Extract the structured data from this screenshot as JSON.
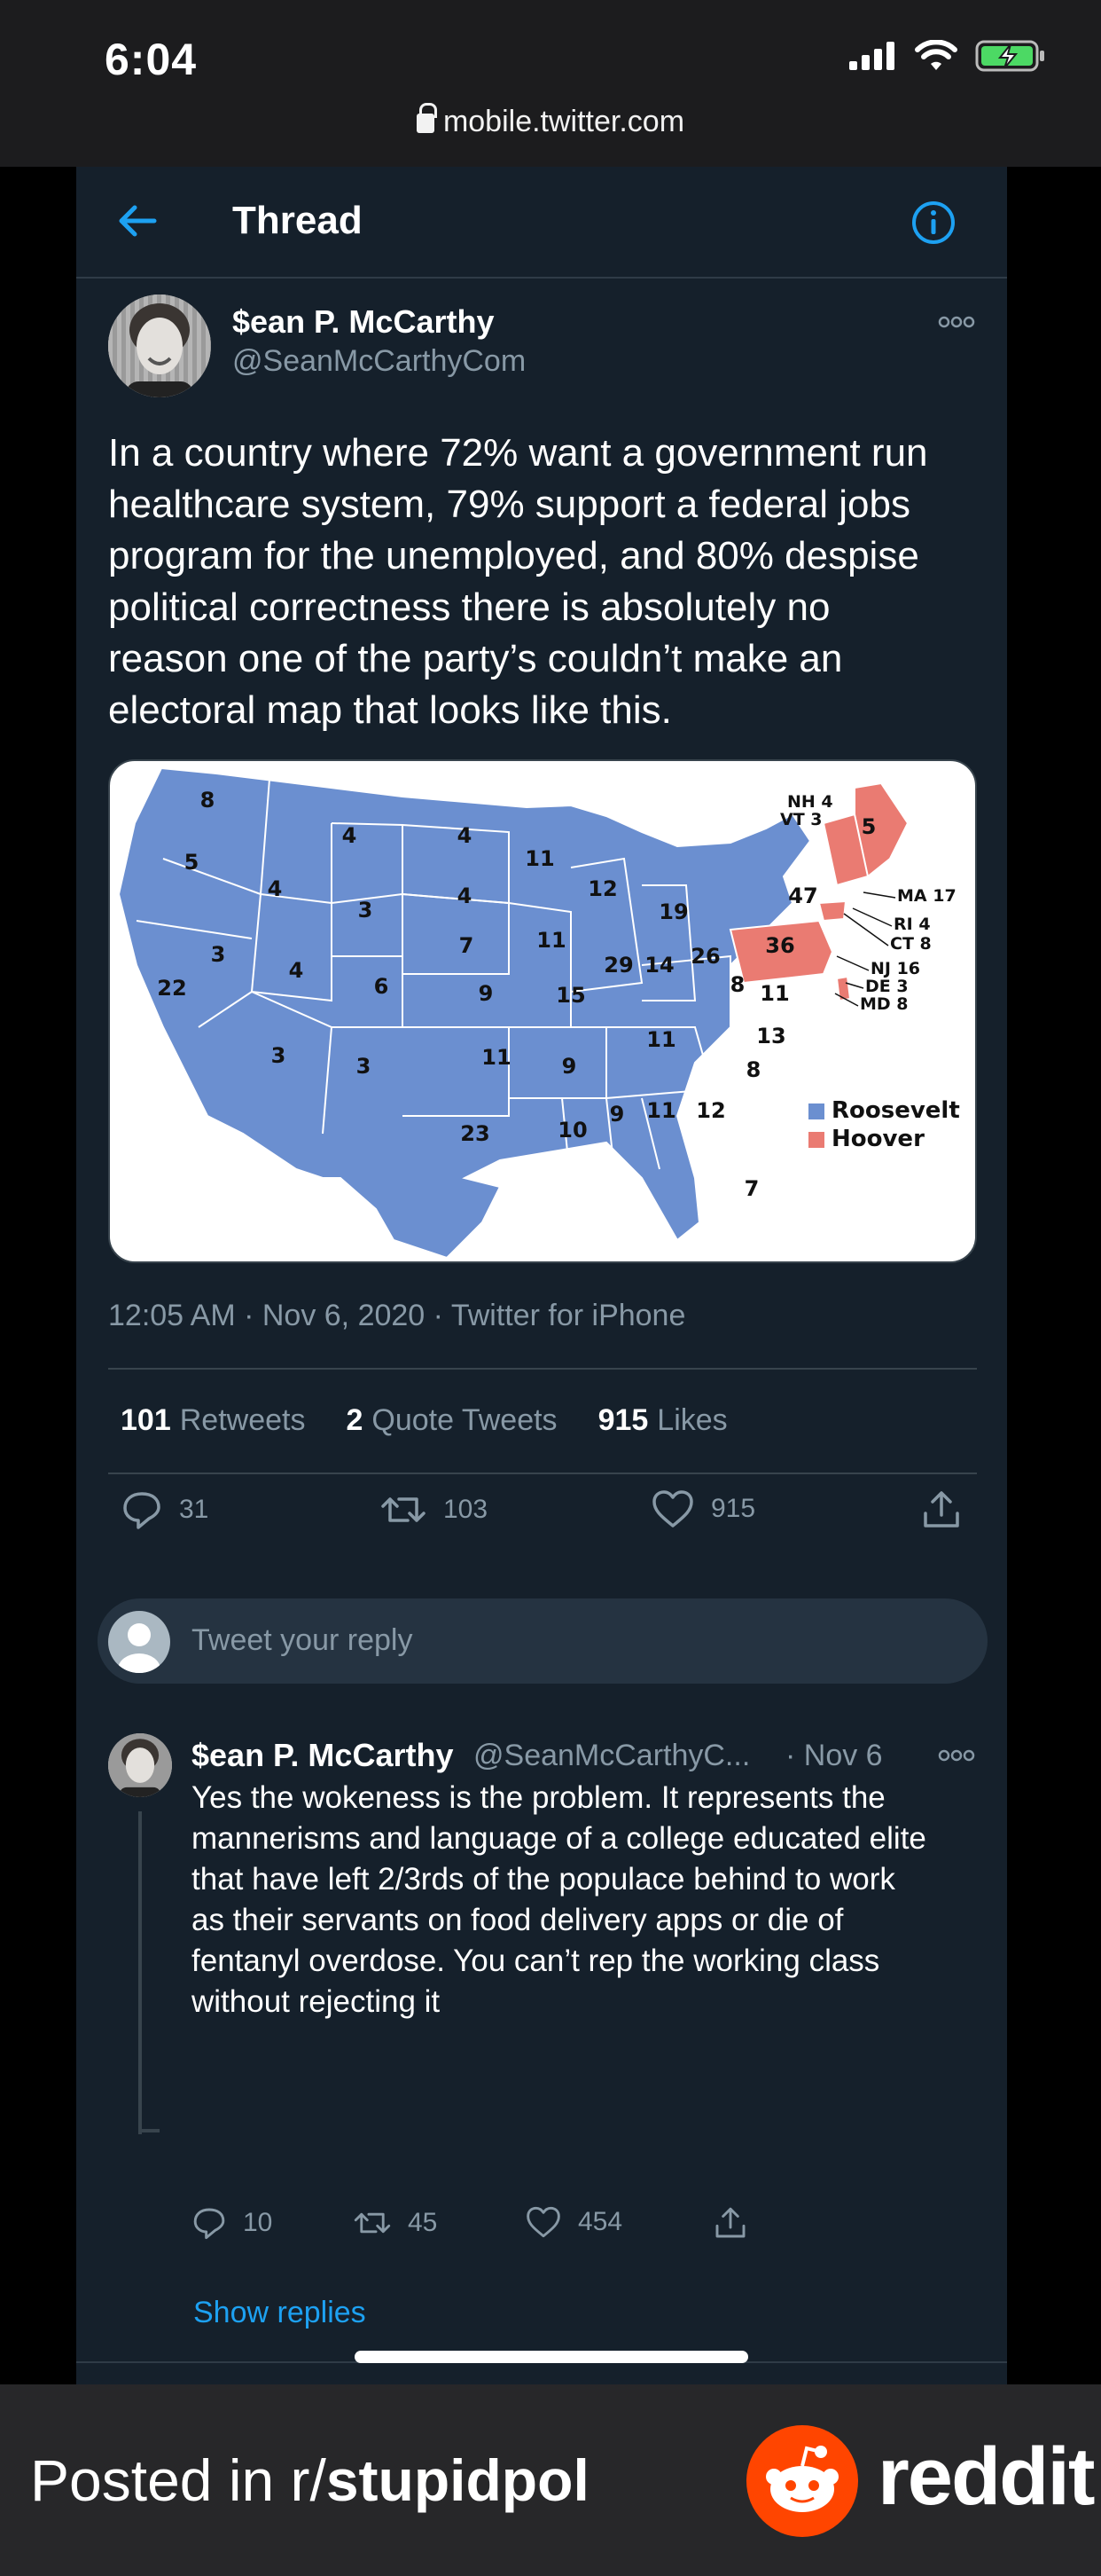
{
  "status": {
    "time": "6:04",
    "url": "mobile.twitter.com"
  },
  "header": {
    "title": "Thread"
  },
  "tweet": {
    "author_name": "$ean P. McCarthy",
    "author_handle": "@SeanMcCarthyCom",
    "lines": [
      "In a country where 72% want a government run",
      "healthcare system, 79% support a federal jobs",
      "program for the unemployed, and 80% despise",
      "political correctness there is absolutely no",
      "reason one of the party’s couldn’t make an",
      "electoral map that looks like this."
    ],
    "meta": "12:05 AM · Nov 6, 2020 · Twitter for iPhone",
    "retweets_count": "101",
    "retweets_label": "Retweets",
    "quote_count": "2",
    "quote_label": "Quote Tweets",
    "likes_count": "915",
    "likes_label": "Likes",
    "action_replies": "31",
    "action_retweets": "103",
    "action_likes": "915"
  },
  "map": {
    "state_numbers": [
      "8",
      "4",
      "4",
      "11",
      "5",
      "4",
      "3",
      "4",
      "12",
      "19",
      "3",
      "4",
      "7",
      "11",
      "22",
      "6",
      "9",
      "15",
      "29",
      "14",
      "26",
      "36",
      "8",
      "11",
      "3",
      "3",
      "11",
      "9",
      "11",
      "13",
      "8",
      "23",
      "10",
      "9",
      "11",
      "12",
      "7",
      "5"
    ],
    "ne_labels": [
      "NH 4",
      "VT 3",
      "MA 17",
      "RI 4",
      "CT 8",
      "NJ 16",
      "DE 3",
      "MD 8",
      "47"
    ],
    "legend_roosevelt": "Roosevelt",
    "legend_hoover": "Hoover",
    "colors": {
      "roosevelt": "#6b8fd0",
      "hoover": "#ea7b72"
    }
  },
  "reply_box": {
    "placeholder": "Tweet your reply"
  },
  "reply": {
    "author_name": "$ean P. McCarthy",
    "author_handle": "@SeanMcCarthyC...",
    "date": "· Nov 6",
    "lines": [
      "Yes the wokeness is the problem. It represents the",
      "mannerisms and language of a college educated elite",
      "that have left 2/3rds of the populace behind to work",
      "as their servants on food delivery apps or die of",
      "fentanyl overdose. You can’t rep the working class",
      "without rejecting it"
    ],
    "replies": "10",
    "retweets": "45",
    "likes": "454",
    "show_replies": "Show replies"
  },
  "footer": {
    "posted_prefix": "Posted in r/",
    "subreddit": "stupidpol",
    "brand": "reddit"
  }
}
